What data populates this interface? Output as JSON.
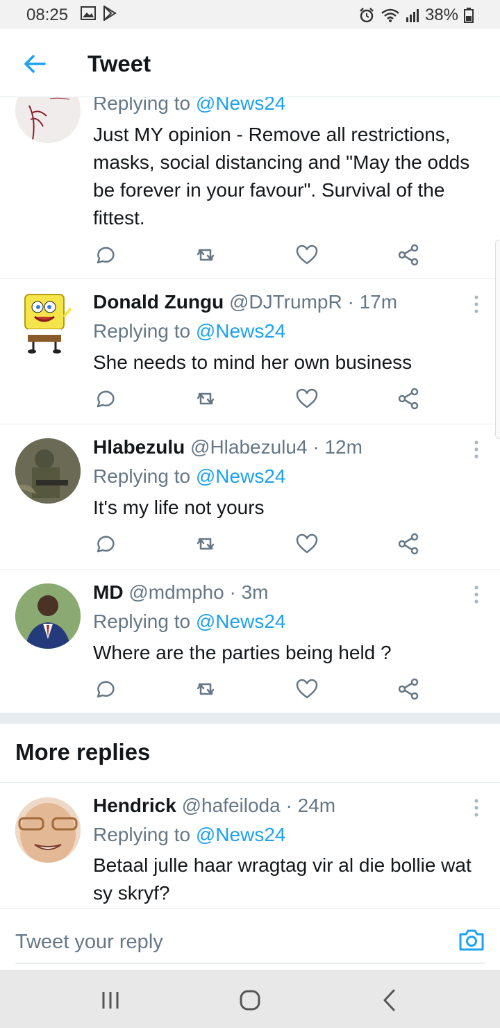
{
  "status_bar": {
    "time": "08:25",
    "battery": "38%"
  },
  "header": {
    "title": "Tweet"
  },
  "tweets": [
    {
      "name": "",
      "handle": "",
      "time": "",
      "replying_prefix": "Replying to ",
      "mention": "@News24",
      "text": "Just MY opinion - Remove all restrictions, masks, social distancing and \"May the odds be forever in your favour\". Survival of the fittest."
    },
    {
      "name": "Donald Zungu",
      "handle": "@DJTrumpR",
      "time": "17m",
      "replying_prefix": "Replying to ",
      "mention": "@News24",
      "text": "She needs to mind her own business"
    },
    {
      "name": "Hlabezulu",
      "handle": "@Hlabezulu4",
      "time": "12m",
      "replying_prefix": "Replying to ",
      "mention": "@News24",
      "text": "It's my life not yours"
    },
    {
      "name": "MD",
      "handle": "@mdmpho",
      "time": "3m",
      "replying_prefix": "Replying to ",
      "mention": "@News24",
      "text": "Where are the parties being held ?"
    },
    {
      "name": "Hendrick",
      "handle": "@hafeiloda",
      "time": "24m",
      "replying_prefix": "Replying to ",
      "mention": "@News24",
      "text": "Betaal julle haar wragtag vir al die bollie wat sy skryf?"
    }
  ],
  "separator": "·",
  "more_replies": {
    "title": "More replies"
  },
  "reply_bar": {
    "placeholder": "Tweet your reply"
  },
  "colors": {
    "accent": "#1da1f2",
    "secondary_text": "#657786",
    "divider": "#e6ecf0"
  },
  "icons": [
    "back-arrow-icon",
    "reply-icon",
    "retweet-icon",
    "like-icon",
    "share-icon",
    "more-options-icon",
    "camera-icon"
  ]
}
